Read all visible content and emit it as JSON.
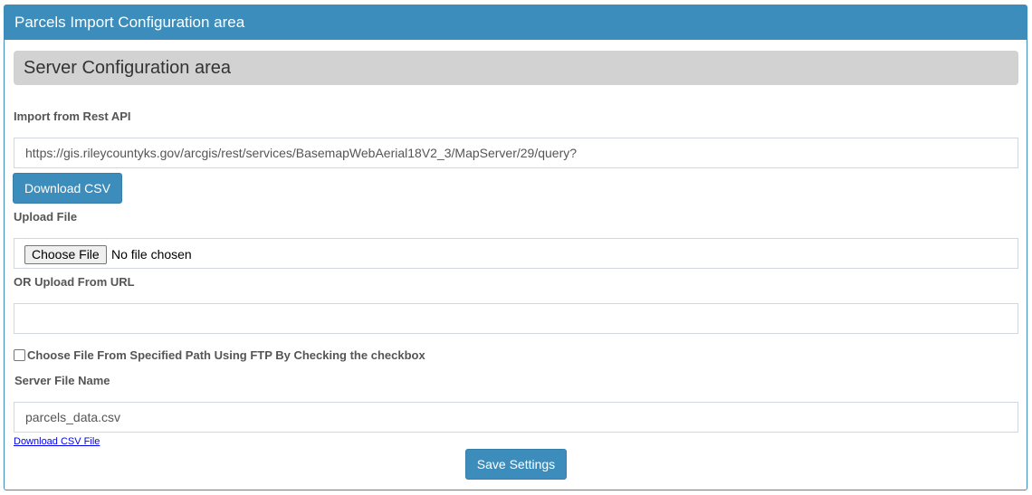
{
  "panel": {
    "title": "Parcels Import Configuration area"
  },
  "section": {
    "title": "Server Configuration area"
  },
  "rest_api": {
    "label": "Import from Rest API",
    "url_value": "https://gis.rileycountyks.gov/arcgis/rest/services/BasemapWebAerial18V2_3/MapServer/29/query?",
    "download_button": "Download CSV"
  },
  "upload_file": {
    "label": "Upload File",
    "choose_button": "Choose File",
    "status": "No file chosen"
  },
  "upload_url": {
    "label": "OR Upload From URL",
    "value": ""
  },
  "ftp": {
    "checkbox_label": "Choose File From Specified Path Using FTP By Checking the checkbox",
    "checked": false
  },
  "server_file": {
    "label": "Server File Name",
    "value": "parcels_data.csv",
    "download_link": "Download CSV File"
  },
  "actions": {
    "save_button": "Save Settings"
  },
  "colors": {
    "primary": "#3c8dbc",
    "section_bar": "#d2d2d2",
    "link": "#0000ee"
  }
}
